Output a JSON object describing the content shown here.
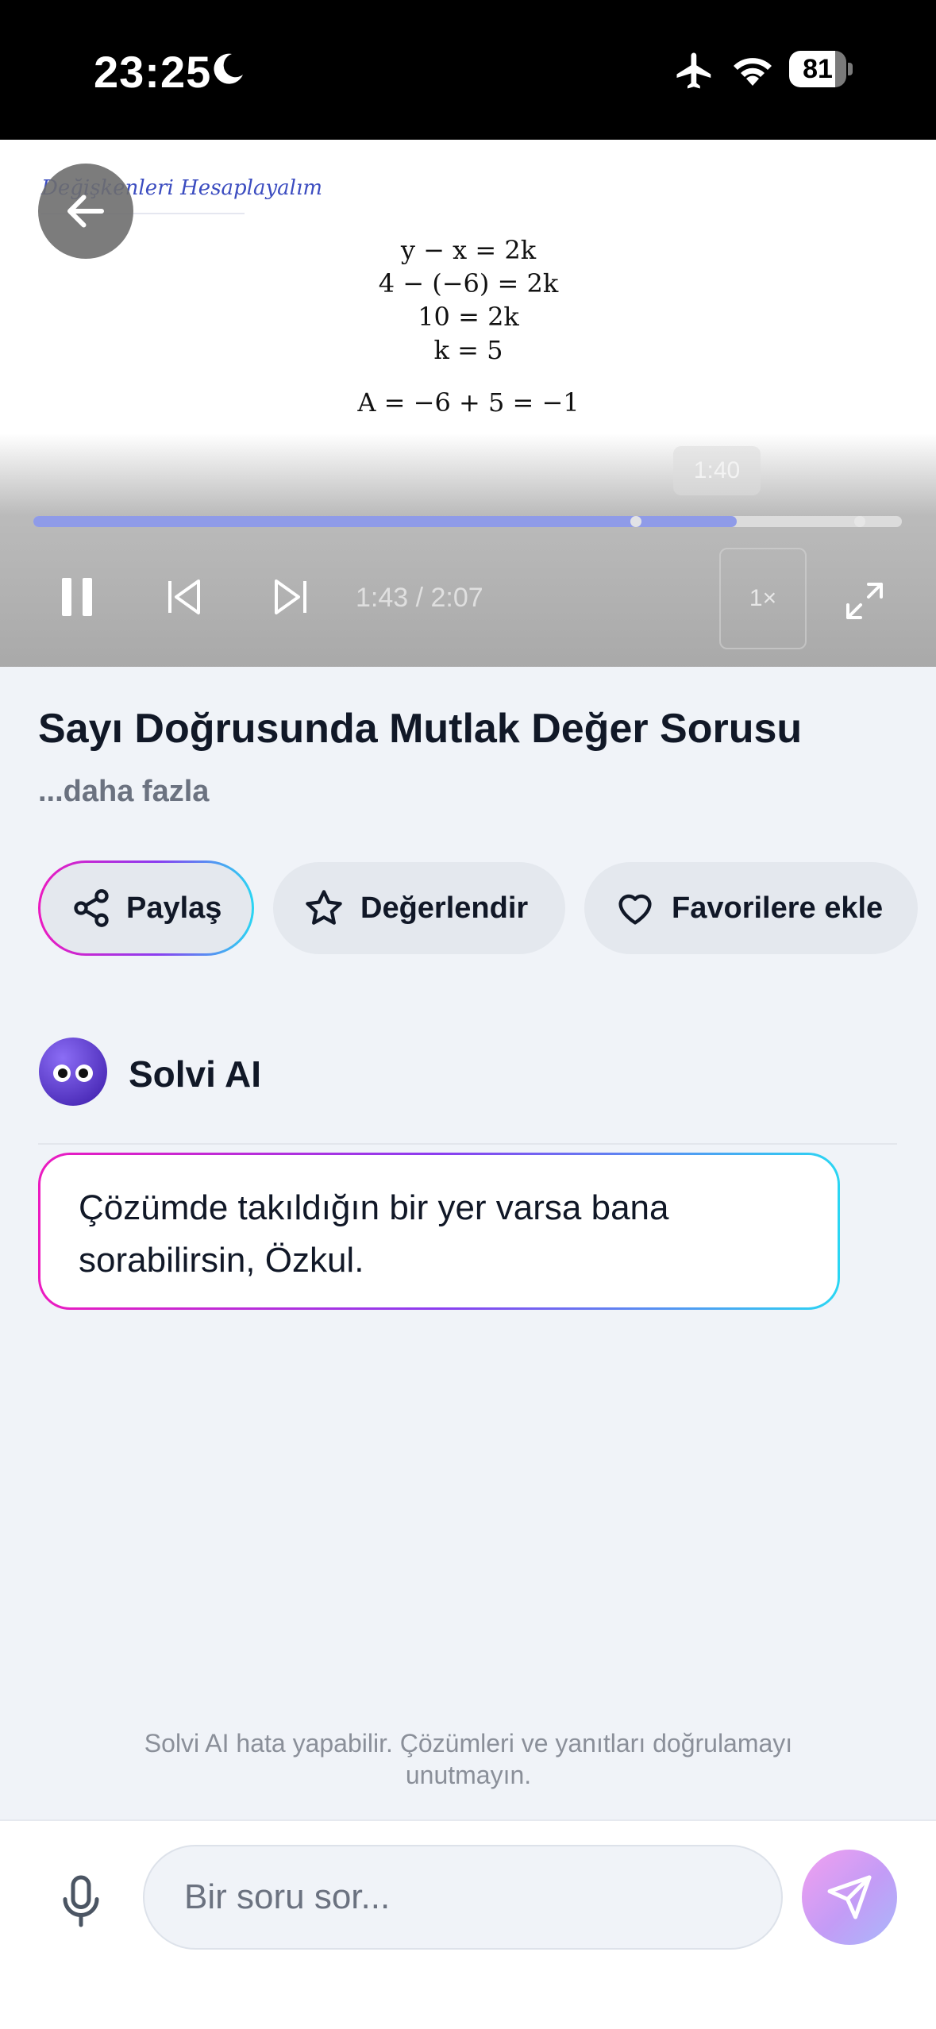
{
  "status_bar": {
    "time": "23:25",
    "battery_percent": "81",
    "battery_level": 0.81,
    "icons": [
      "moon-icon",
      "airplane-icon",
      "wifi-icon",
      "battery-icon"
    ]
  },
  "video": {
    "overlay_title": "Değişkenleri Hesaplayalım",
    "math_lines": [
      "y − x = 2k",
      "4 − (−6) = 2k",
      "10 = 2k",
      "k = 5",
      "A = −6 + 5 = −1"
    ],
    "hover_time": "1:40",
    "time_display": "1:43 / 2:07",
    "progress": 0.81,
    "speed_label": "1×"
  },
  "content": {
    "title": "Sayı Doğrusunda Mutlak Değer Sorusu",
    "more_label": "...daha fazla",
    "actions": {
      "share": "Paylaş",
      "rate": "Değerlendir",
      "favorite": "Favorilere ekle"
    }
  },
  "assistant": {
    "name": "Solvi AI",
    "message": "Çözümde takıldığın bir yer varsa bana sorabilirsin, Özkul."
  },
  "disclaimer": "Solvi AI hata yapabilir. Çözümleri ve yanıtları doğrulamayı unutmayın.",
  "composer": {
    "placeholder": "Bir soru sor..."
  },
  "colors": {
    "accent_gradient": [
      "#ec1ac0",
      "#8b3df0",
      "#2ad6f3"
    ],
    "progress": "#8f9be8",
    "background": "#f0f3f8"
  }
}
